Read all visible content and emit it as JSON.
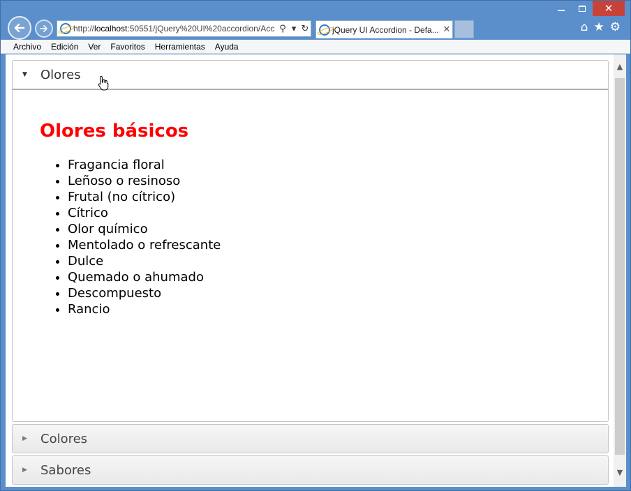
{
  "browser": {
    "address": {
      "prefix": "http://",
      "host": "localhost",
      "rest": ":50551/jQuery%20UI%20accordion/Acc"
    },
    "tab_title": "jQuery UI Accordion - Defa...",
    "menu": [
      "Archivo",
      "Edición",
      "Ver",
      "Favoritos",
      "Herramientas",
      "Ayuda"
    ]
  },
  "accordion": {
    "sections": [
      {
        "label": "Olores",
        "expanded": true
      },
      {
        "label": "Colores",
        "expanded": false
      },
      {
        "label": "Sabores",
        "expanded": false
      }
    ],
    "panel": {
      "title": "Olores básicos",
      "items": [
        "Fragancia floral",
        "Leñoso o resinoso",
        "Frutal (no cítrico)",
        "Cítrico",
        "Olor químico",
        "Mentolado o refrescante",
        "Dulce",
        "Quemado o ahumado",
        "Descompuesto",
        "Rancio"
      ]
    }
  },
  "colors": {
    "title_red": "#ff0000",
    "chrome_blue": "#5b8fcb"
  }
}
